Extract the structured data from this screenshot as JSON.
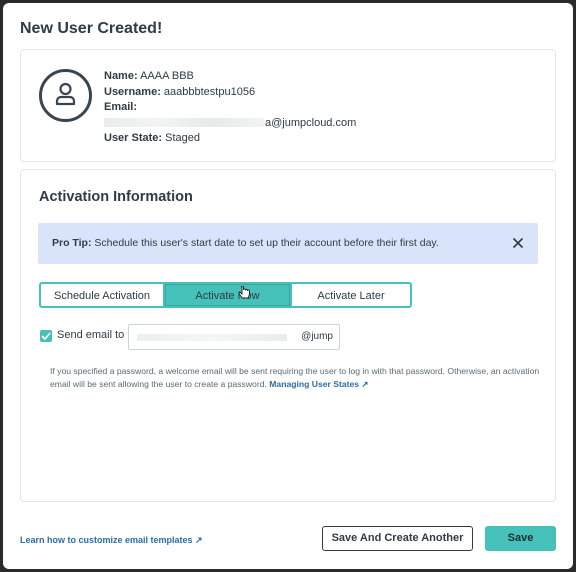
{
  "modal": {
    "title": "New User Created!"
  },
  "user": {
    "name_label": "Name:",
    "name_value": "AAAA BBB",
    "username_label": "Username:",
    "username_value": "aaabbbtestpu1056",
    "email_label": "Email:",
    "email_value_suffix": "a@jumpcloud.com",
    "state_label": "User State:",
    "state_value": "Staged"
  },
  "activation": {
    "title": "Activation Information",
    "pro_tip_label": "Pro Tip:",
    "pro_tip_text": "Schedule this user's start date to set up their account before their first day.",
    "tabs": [
      {
        "label": "Schedule Activation",
        "selected": false
      },
      {
        "label": "Activate Now",
        "selected": true
      },
      {
        "label": "Activate Later",
        "selected": false
      }
    ],
    "send_email_label": "Send email to",
    "send_email_checked": true,
    "email_input_suffix": "@jump",
    "help_text": "If you specified a password, a welcome email will be sent requiring the user to log in with that password. Otherwise, an activation email will be sent allowing the user to create a password.",
    "help_link": "Managing User States ↗"
  },
  "footer": {
    "templates_link": "Learn how to customize email templates ↗",
    "save_and_create_label": "Save And Create Another",
    "save_label": "Save"
  },
  "colors": {
    "accent": "#46c1b9",
    "link": "#2d6ca6",
    "tip_bg": "#d9e4fb",
    "text": "#2f3b45"
  }
}
